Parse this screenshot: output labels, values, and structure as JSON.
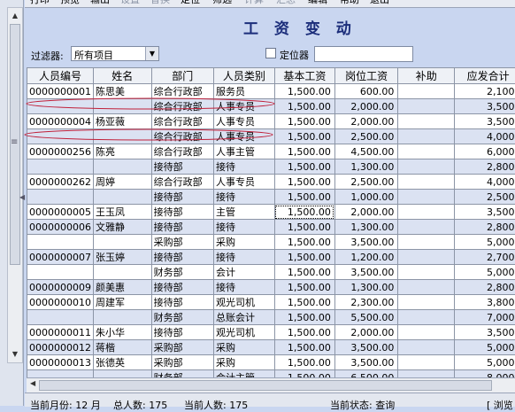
{
  "menu": [
    "打印",
    "预览",
    "输出",
    "设置",
    "替换",
    "定位",
    "筛选",
    "计算",
    "汇总",
    "编辑",
    "帮助",
    "退出"
  ],
  "title": "工 资 变 动",
  "filter": {
    "label": "过滤器:",
    "value": "所有项目"
  },
  "locator": {
    "label": "定位器",
    "value": ""
  },
  "table": {
    "headers": [
      "人员编号",
      "姓名",
      "部门",
      "人员类别",
      "基本工资",
      "岗位工资",
      "补助",
      "应发合计"
    ],
    "rows": [
      [
        "0000000001",
        "陈思美",
        "综合行政部",
        "服务员",
        "1,500.00",
        "600.00",
        "",
        "2,100."
      ],
      [
        "",
        "",
        "综合行政部",
        "人事专员",
        "1,500.00",
        "2,000.00",
        "",
        "3,500."
      ],
      [
        "0000000004",
        "杨亚薇",
        "综合行政部",
        "人事专员",
        "1,500.00",
        "2,000.00",
        "",
        "3,500."
      ],
      [
        "",
        "",
        "综合行政部",
        "人事专员",
        "1,500.00",
        "2,500.00",
        "",
        "4,000."
      ],
      [
        "0000000256",
        "陈亮",
        "综合行政部",
        "人事主管",
        "1,500.00",
        "4,500.00",
        "",
        "6,000."
      ],
      [
        "",
        "",
        "接待部",
        "接待",
        "1,500.00",
        "1,300.00",
        "",
        "2,800."
      ],
      [
        "0000000262",
        "周婷",
        "综合行政部",
        "人事专员",
        "1,500.00",
        "2,500.00",
        "",
        "4,000."
      ],
      [
        "",
        "",
        "接待部",
        "接待",
        "1,500.00",
        "1,000.00",
        "",
        "2,500."
      ],
      [
        "0000000005",
        "王玉凤",
        "接待部",
        "主管",
        "1,500.00",
        "2,000.00",
        "",
        "3,500."
      ],
      [
        "0000000006",
        "文雅静",
        "接待部",
        "接待",
        "1,500.00",
        "1,300.00",
        "",
        "2,800."
      ],
      [
        "",
        "",
        "采购部",
        "采购",
        "1,500.00",
        "3,500.00",
        "",
        "5,000."
      ],
      [
        "0000000007",
        "张玉婷",
        "接待部",
        "接待",
        "1,500.00",
        "1,200.00",
        "",
        "2,700."
      ],
      [
        "",
        "",
        "财务部",
        "会计",
        "1,500.00",
        "3,500.00",
        "",
        "5,000."
      ],
      [
        "0000000009",
        "颜美惠",
        "接待部",
        "接待",
        "1,500.00",
        "1,300.00",
        "",
        "2,800."
      ],
      [
        "0000000010",
        "周建军",
        "接待部",
        "观光司机",
        "1,500.00",
        "2,300.00",
        "",
        "3,800."
      ],
      [
        "",
        "",
        "财务部",
        "总账会计",
        "1,500.00",
        "5,500.00",
        "",
        "7,000."
      ],
      [
        "0000000011",
        "朱小华",
        "接待部",
        "观光司机",
        "1,500.00",
        "2,000.00",
        "",
        "3,500."
      ],
      [
        "0000000012",
        "蒋楷",
        "采购部",
        "采购",
        "1,500.00",
        "3,500.00",
        "",
        "5,000."
      ],
      [
        "0000000013",
        "张德英",
        "采购部",
        "采购",
        "1,500.00",
        "3,500.00",
        "",
        "5,000."
      ],
      [
        "",
        "",
        "财务部",
        "会计主管",
        "1,500.00",
        "6,500.00",
        "",
        "8,000."
      ]
    ]
  },
  "status": {
    "month": "当前月份: 12 月",
    "total": "总人数: 175",
    "current": "当前人数: 175",
    "state": "当前状态: 查询",
    "last": "[ 浏览"
  },
  "colors": {
    "background": "#c9d6f0",
    "title": "#1b2d7a",
    "annotation": "#c0203a"
  }
}
